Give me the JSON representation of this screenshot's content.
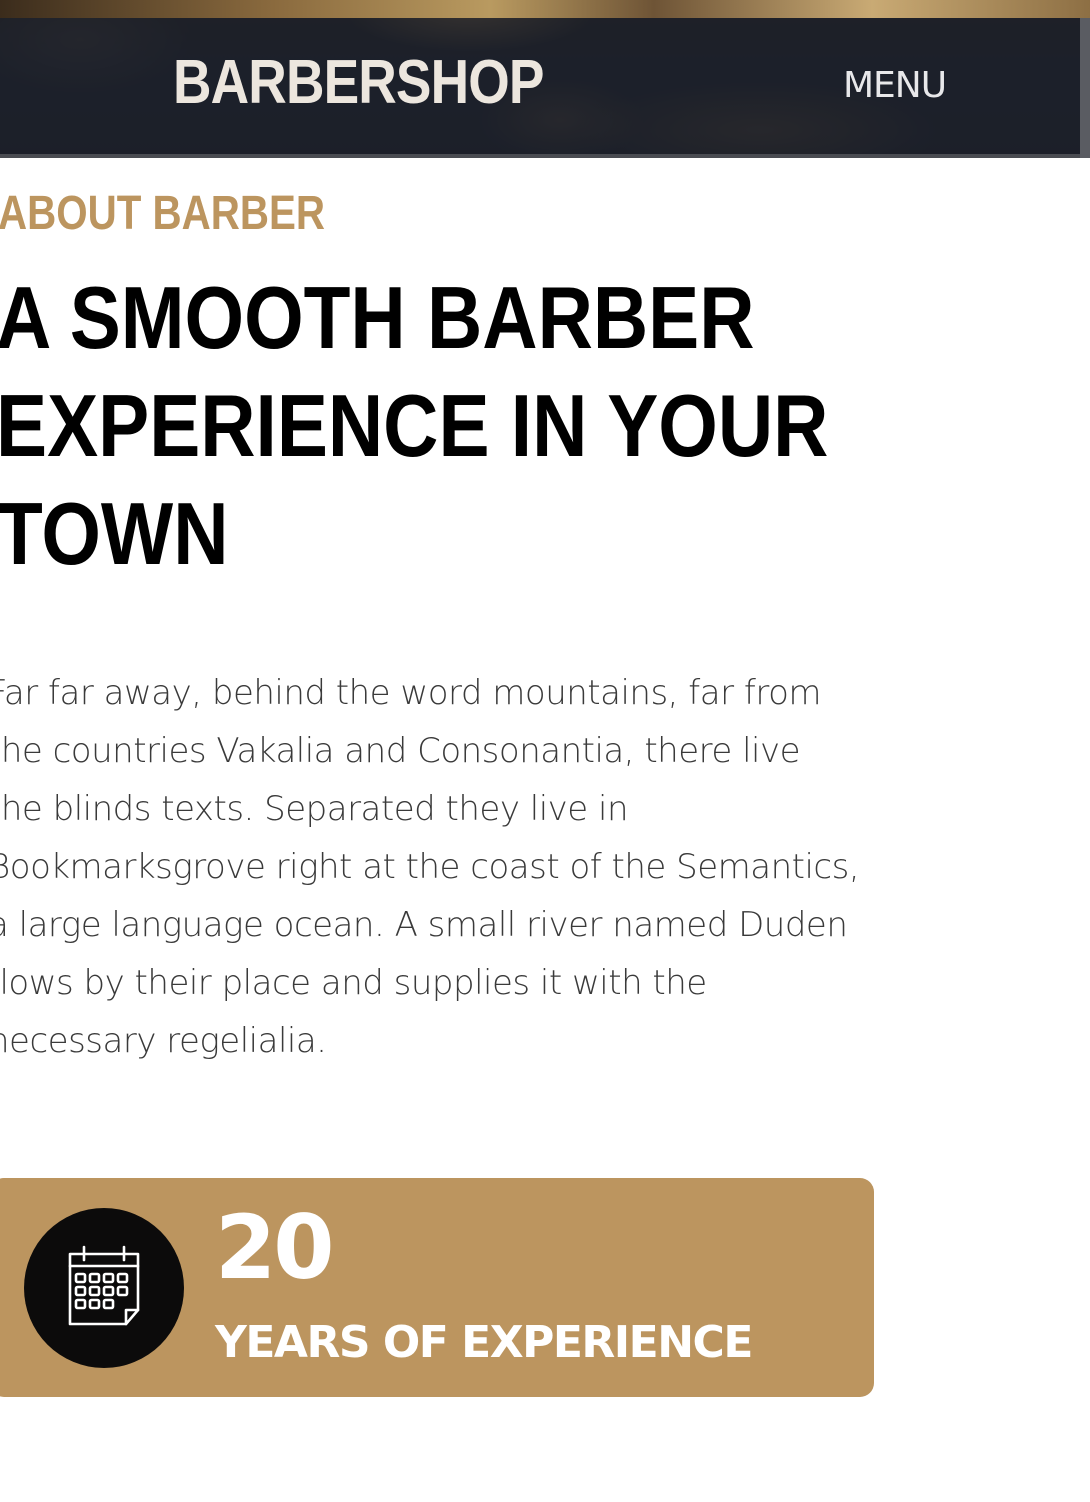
{
  "header": {
    "brand": "BARBERSHOP",
    "menu_label": "MENU"
  },
  "about": {
    "eyebrow": "ABOUT BARBER",
    "headline_lines": [
      "A SMOOTH BARBER",
      "EXPERIENCE IN YOUR",
      "TOWN"
    ],
    "body_lines": [
      "Far far away, behind the word mountains, far from",
      "the countries Vakalia and Consonantia, there live",
      "the blinds texts. Separated they live in",
      "Bookmarksgrove right at the coast of the Semantics,",
      "a large language ocean. A small river named Duden",
      "flows by their place and supplies it with the",
      "necessary regelialia."
    ]
  },
  "stat": {
    "icon": "calendar-icon",
    "number": "20",
    "label": "YEARS OF EXPERIENCE"
  },
  "colors": {
    "accent": "#bc955f",
    "header_overlay": "#1a1f2a",
    "icon_circle": "#0c0b0b",
    "headline": "#000000",
    "body": "#3a3a3a"
  }
}
